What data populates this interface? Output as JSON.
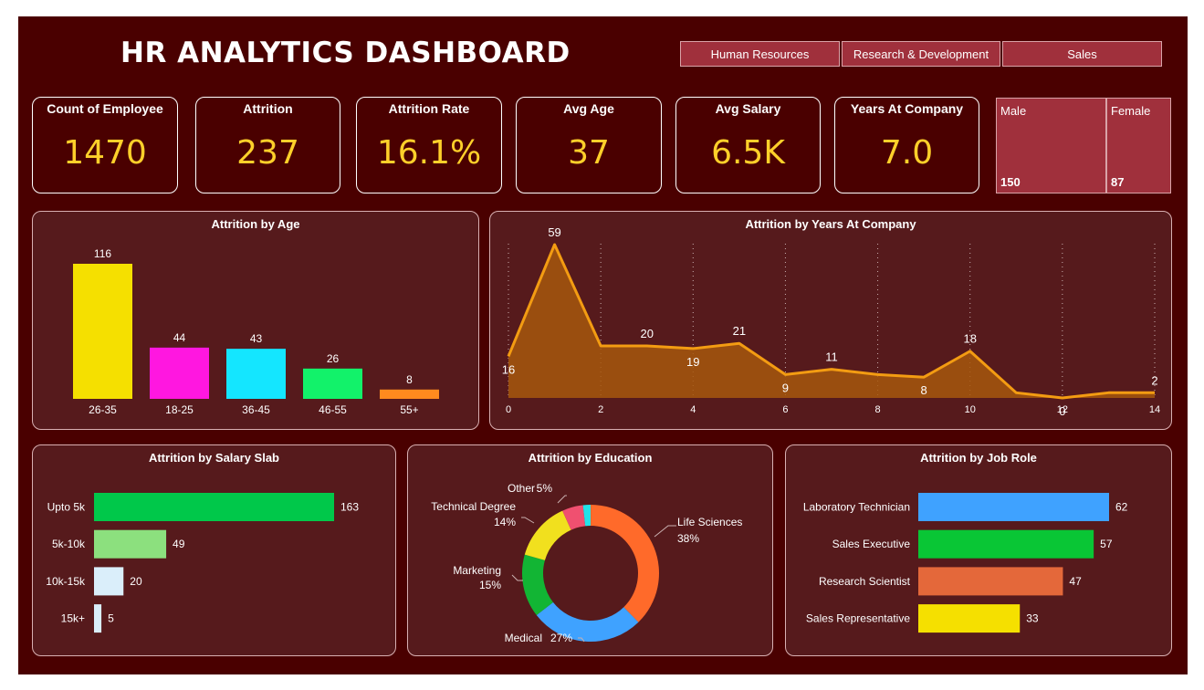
{
  "header": {
    "title": "HR ANALYTICS DASHBOARD"
  },
  "departments": [
    "Human Resources",
    "Research & Development",
    "Sales"
  ],
  "kpis": [
    {
      "label": "Count of Employee",
      "value": "1470"
    },
    {
      "label": "Attrition",
      "value": "237"
    },
    {
      "label": "Attrition Rate",
      "value": "16.1%"
    },
    {
      "label": "Avg Age",
      "value": "37"
    },
    {
      "label": "Avg Salary",
      "value": "6.5K"
    },
    {
      "label": "Years At Company",
      "value": "7.0"
    }
  ],
  "gender": {
    "male": {
      "label": "Male",
      "value": "150"
    },
    "female": {
      "label": "Female",
      "value": "87"
    }
  },
  "colors": {
    "background": "#4a0000",
    "panel": "#561a1c",
    "accent": "#ffd02a",
    "slicer": "#a0303c"
  },
  "chart_data": [
    {
      "id": "age",
      "type": "bar",
      "title": "Attrition by Age",
      "categories": [
        "26-35",
        "18-25",
        "36-45",
        "46-55",
        "55+"
      ],
      "values": [
        116,
        44,
        43,
        26,
        8
      ],
      "colors": [
        "#f5e000",
        "#ff17e0",
        "#14e6ff",
        "#12f26a",
        "#ff8a1e"
      ],
      "ylim": [
        0,
        116
      ]
    },
    {
      "id": "years",
      "type": "area",
      "title": "Attrition by Years At Company",
      "x": [
        0,
        1,
        2,
        3,
        4,
        5,
        6,
        7,
        8,
        9,
        10,
        11,
        12,
        13,
        14
      ],
      "values": [
        16,
        59,
        20,
        20,
        19,
        21,
        9,
        11,
        9,
        8,
        18,
        2,
        0,
        2,
        2
      ],
      "labels": {
        "0": "16",
        "1": "59",
        "3": "20",
        "4": "19",
        "5": "21",
        "6": "9",
        "7": "11",
        "9": "8",
        "10": "18",
        "12": "0",
        "14": "2"
      },
      "xticks": [
        "0",
        "2",
        "4",
        "6",
        "8",
        "10",
        "12",
        "14"
      ],
      "grid": true,
      "color": "#f39c12"
    },
    {
      "id": "salary",
      "type": "bar",
      "orientation": "horizontal",
      "title": "Attrition by Salary Slab",
      "categories": [
        "Upto 5k",
        "5k-10k",
        "10k-15k",
        "15k+"
      ],
      "values": [
        163,
        49,
        20,
        5
      ],
      "colors": [
        "#00c84a",
        "#8ce07e",
        "#daeefa",
        "#daeefa"
      ]
    },
    {
      "id": "education",
      "type": "pie",
      "title": "Attrition by Education",
      "slices": [
        {
          "name": "Life Sciences",
          "pct": "38%",
          "value": 38,
          "color": "#ff6a2a"
        },
        {
          "name": "Medical",
          "pct": "27%",
          "value": 27,
          "color": "#3fa2ff"
        },
        {
          "name": "Marketing",
          "pct": "15%",
          "value": 15,
          "color": "#12b534"
        },
        {
          "name": "Technical Degree",
          "pct": "14%",
          "value": 14,
          "color": "#f1e01e"
        },
        {
          "name": "Other",
          "pct": "5%",
          "value": 5,
          "color": "#f05070"
        },
        {
          "name": "",
          "pct": "",
          "value": 1.8,
          "color": "#22e3e8"
        }
      ]
    },
    {
      "id": "jobrole",
      "type": "bar",
      "orientation": "horizontal",
      "title": "Attrition by Job Role",
      "categories": [
        "Laboratory Technician",
        "Sales Executive",
        "Research Scientist",
        "Sales Representative"
      ],
      "values": [
        62,
        57,
        47,
        33
      ],
      "colors": [
        "#3fa2ff",
        "#09c635",
        "#e4683a",
        "#f5e000"
      ]
    }
  ]
}
